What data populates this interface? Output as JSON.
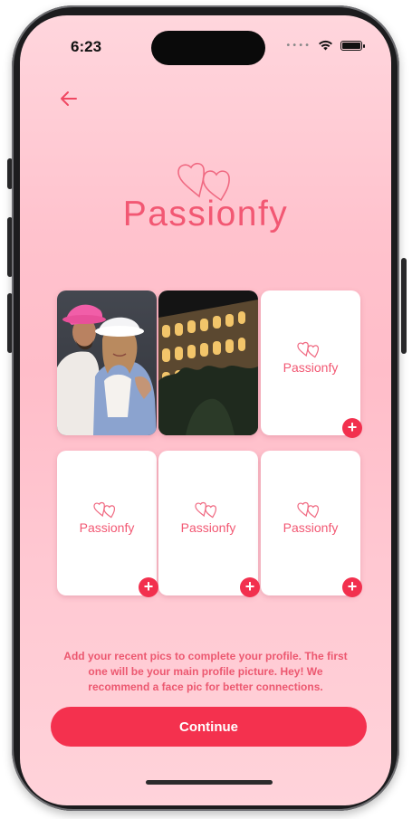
{
  "status_bar": {
    "time": "6:23"
  },
  "header": {
    "back_icon": "arrow-left-icon",
    "brand_name": "Passionfy"
  },
  "photos": [
    {
      "slot": 1,
      "filled": true,
      "description": "couple-selfie"
    },
    {
      "slot": 2,
      "filled": true,
      "description": "colosseum-night"
    },
    {
      "slot": 3,
      "filled": false,
      "placeholder_brand": "Passionfy"
    },
    {
      "slot": 4,
      "filled": false,
      "placeholder_brand": "Passionfy"
    },
    {
      "slot": 5,
      "filled": false,
      "placeholder_brand": "Passionfy"
    },
    {
      "slot": 6,
      "filled": false,
      "placeholder_brand": "Passionfy"
    }
  ],
  "add_label": "+",
  "hint_text": "Add your recent pics to complete your profile. The first one will be your main profile picture. Hey! We recommend a face pic for better connections.",
  "continue_label": "Continue",
  "colors": {
    "accent": "#f4314e",
    "brand": "#f25873",
    "background": "#ffc2cd"
  }
}
